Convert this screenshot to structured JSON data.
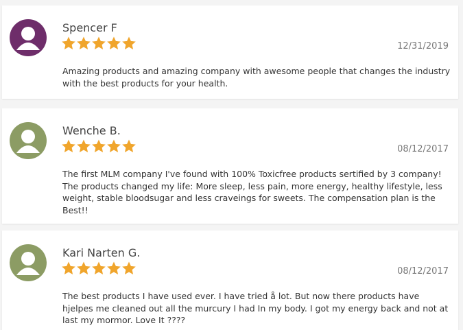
{
  "colors": {
    "star": "#f0a52c",
    "avatar_purple": "#6e2d6a",
    "avatar_green": "#8c9c64"
  },
  "reviews": [
    {
      "name": "Spencer F",
      "date": "12/31/2019",
      "rating": 5,
      "avatar_color": "#6e2d6a",
      "avatar_icon": "user-silhouette-icon",
      "lines": [
        "Amazing products and amazing company with awesome people that changes the industry",
        "with the best products for your health."
      ]
    },
    {
      "name": "Wenche B.",
      "date": "08/12/2017",
      "rating": 5,
      "avatar_color": "#8c9c64",
      "avatar_icon": "user-silhouette-icon",
      "lines": [
        "The first MLM company I've found with 100% Toxicfree products sertified by 3 company!",
        "The products changed my life: More sleep, less pain, more energy, healthy lifestyle, less",
        "weight, stable bloodsugar and less craveings for sweets. The compensation plan is the",
        "Best!!"
      ]
    },
    {
      "name": "Kari Narten G.",
      "date": "08/12/2017",
      "rating": 5,
      "avatar_color": "#8c9c64",
      "avatar_icon": "user-silhouette-icon",
      "lines": [
        "The best products I have used ever. I have tried å lot. But now there products have",
        "hjelpes me cleaned out all the murcury I had In my body. I got my energy back and not at",
        "last my mormor. Love It ????"
      ]
    }
  ]
}
